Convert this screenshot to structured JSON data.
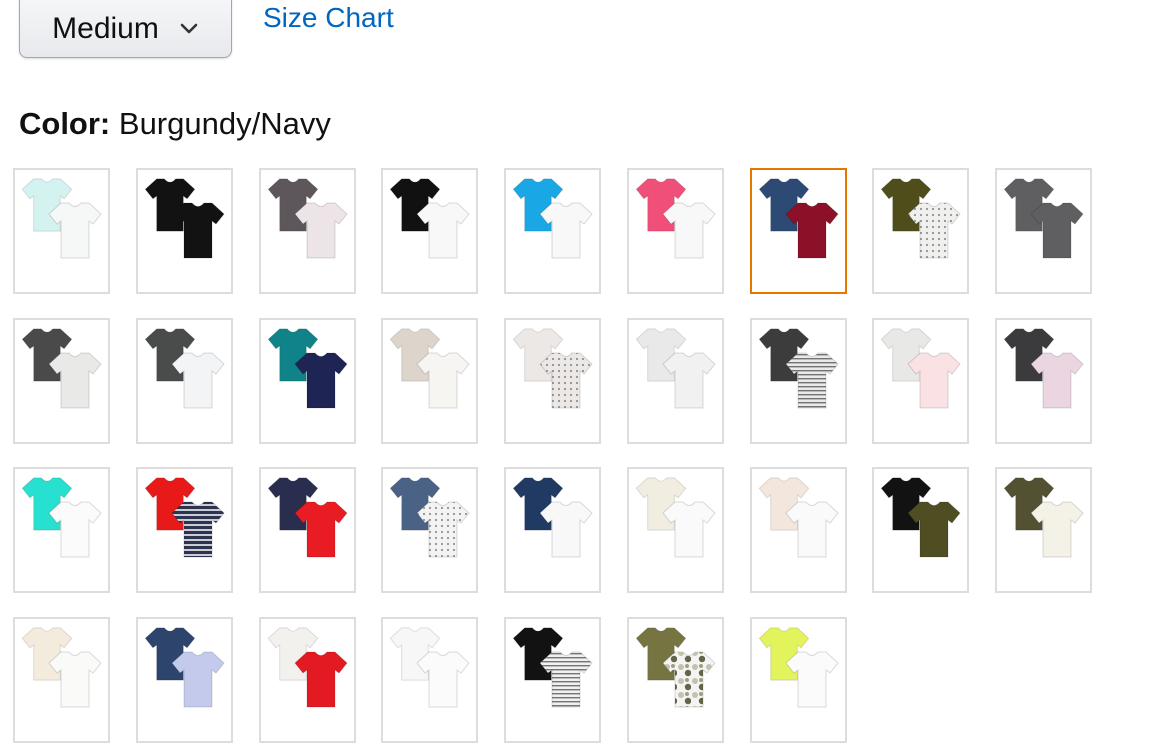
{
  "size_selector": {
    "value": "Medium",
    "icon": "chevron-down-icon"
  },
  "size_chart_link": "Size Chart",
  "color": {
    "label": "Color:",
    "selected": "Burgundy/Navy"
  },
  "accent": {
    "link": "#0066c0",
    "selected_border": "#e77600",
    "swatch_border": "#dddddd"
  },
  "swatches": [
    {
      "back": "#d4f2f0",
      "front": "#f6f7f7"
    },
    {
      "back": "#121212",
      "front": "#121212"
    },
    {
      "back": "#5d575c",
      "front": "#ece4e6"
    },
    {
      "back": "#111111",
      "front": "#f8f8f8"
    },
    {
      "back": "#1aa7e6",
      "front": "#f8f8f8"
    },
    {
      "back": "#ef4f78",
      "front": "#f8f8f8"
    },
    {
      "back": "#2c4a74",
      "front": "#8c1028"
    },
    {
      "back": "#4f4e1b",
      "front": "#f0f0ee",
      "pattern": "dots"
    },
    {
      "back": "#5f5f62",
      "front": "#5f5f62"
    },
    {
      "back": "#4a4a4a",
      "front": "#e9e9e7"
    },
    {
      "back": "#4a4b4b",
      "front": "#f3f4f6"
    },
    {
      "back": "#0f8387",
      "front": "#1e2454"
    },
    {
      "back": "#ddd5cc",
      "front": "#f6f5f2"
    },
    {
      "back": "#ece8e6",
      "front": "#ece8e6",
      "pattern": "dots"
    },
    {
      "back": "#e9e9e9",
      "front": "#f1f1f1"
    },
    {
      "back": "#3c3c3c",
      "front": "#eaeaea",
      "pattern": "stripes"
    },
    {
      "back": "#e8e8e6",
      "front": "#f9e1e4"
    },
    {
      "back": "#3b3b3d",
      "front": "#ead5e1"
    },
    {
      "back": "#28e0cf",
      "front": "#fbfbfb"
    },
    {
      "back": "#e81919",
      "front": "#2d3452",
      "pattern": "stripes-wide"
    },
    {
      "back": "#2a2e4e",
      "front": "#e91b23"
    },
    {
      "back": "#4b6287",
      "front": "#f3f3f3",
      "pattern": "dots"
    },
    {
      "back": "#213a64",
      "front": "#f8f8f8"
    },
    {
      "back": "#f1ede0",
      "front": "#fafafa"
    },
    {
      "back": "#f3e6dc",
      "front": "#fafafa"
    },
    {
      "back": "#121212",
      "front": "#4f4e23"
    },
    {
      "back": "#535131",
      "front": "#f4f1e6"
    },
    {
      "back": "#f3ecdc",
      "front": "#fafaf8"
    },
    {
      "back": "#2d446d",
      "front": "#c4caeb"
    },
    {
      "back": "#f3f1ee",
      "front": "#e31a22"
    },
    {
      "back": "#f7f7f7",
      "front": "#fbfbfb"
    },
    {
      "back": "#121212",
      "front": "#f0f0f0",
      "pattern": "stripes"
    },
    {
      "back": "#767542",
      "front": "#f4f4f4",
      "pattern": "camo"
    },
    {
      "back": "#e3f35b",
      "front": "#fbfbfb"
    }
  ],
  "selected_index": 6
}
